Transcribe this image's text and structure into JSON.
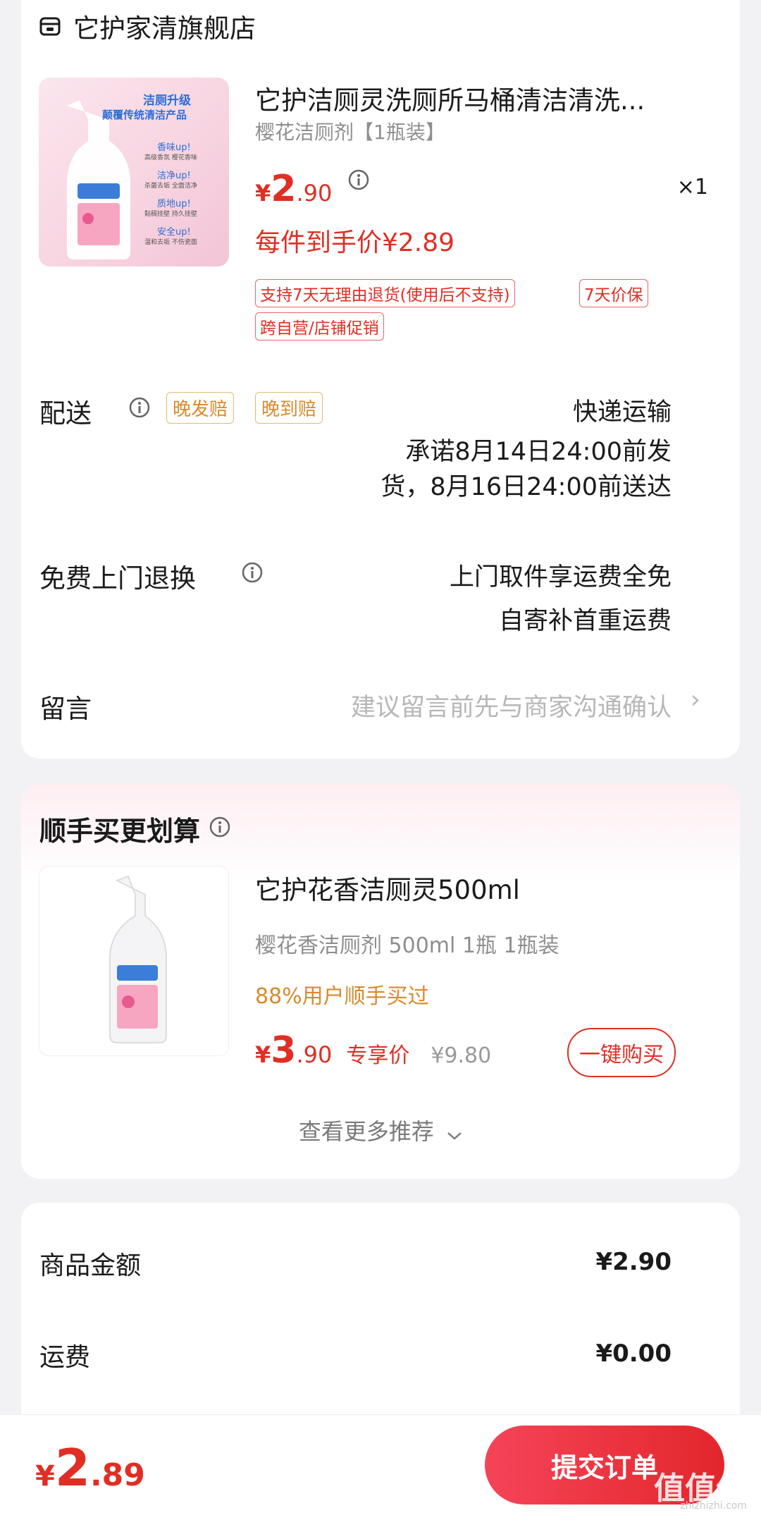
{
  "store": {
    "name": "它护家清旗舰店",
    "icon": "store-icon"
  },
  "product": {
    "title": "它护洁厕灵洗厕所马桶清洁清洗...",
    "spec": "樱花洁厕剂【1瓶装】",
    "price_yen": "¥",
    "price_int": "2",
    "price_dec": ".90",
    "qty": "×1",
    "unit_price": "每件到手价¥2.89",
    "tags": [
      "支持7天无理由退货(使用后不支持)",
      "7天价保",
      "跨自营/店铺促销"
    ],
    "image_text": {
      "headline1": "洁厕升级",
      "headline2": "颠覆传统清洁产品",
      "f1": "香味up!",
      "f1s": "高级香氛 樱花香味",
      "f2": "洁净up!",
      "f2s": "杀菌去垢 全面洁净",
      "f3": "质地up!",
      "f3s": "黏稠挂壁 持久挂壁",
      "f4": "安全up!",
      "f4s": "温和去垢 不伤瓷面"
    }
  },
  "delivery": {
    "label": "配送",
    "badges": [
      "晚发赔",
      "晚到赔"
    ],
    "method": "快递运输",
    "promise_line1": "承诺8月14日24:00前发",
    "promise_line2": "货，8月16日24:00前送达"
  },
  "returns": {
    "label": "免费上门退换",
    "line1": "上门取件享运费全免",
    "line2": "自寄补首重运费"
  },
  "message": {
    "label": "留言",
    "placeholder": "建议留言前先与商家沟通确认",
    "chevron": "›"
  },
  "recommend": {
    "section_title": "顺手买更划算",
    "title": "它护花香洁厕灵500ml",
    "spec": "樱花香洁厕剂 500ml 1瓶   1瓶装",
    "bought": "88%用户顺手买过",
    "price_yen": "¥",
    "price_int": "3",
    "price_dec": ".90",
    "exclusive": "专享价",
    "original": "¥9.80",
    "buy_label": "一键购买",
    "more_label": "查看更多推荐"
  },
  "summary": {
    "goods_label": "商品金额",
    "goods_value": "¥2.90",
    "shipping_label": "运费",
    "shipping_value": "¥0.00"
  },
  "footer": {
    "total_yen": "¥",
    "total_int": "2",
    "total_dec": ".89",
    "submit_label": "提交订单",
    "watermark": "值值值",
    "watermark_sub": "zhizhizhi.com"
  },
  "colors": {
    "accent": "#e02e24",
    "orange": "#d98a2b",
    "background": "#f2f2f4"
  }
}
